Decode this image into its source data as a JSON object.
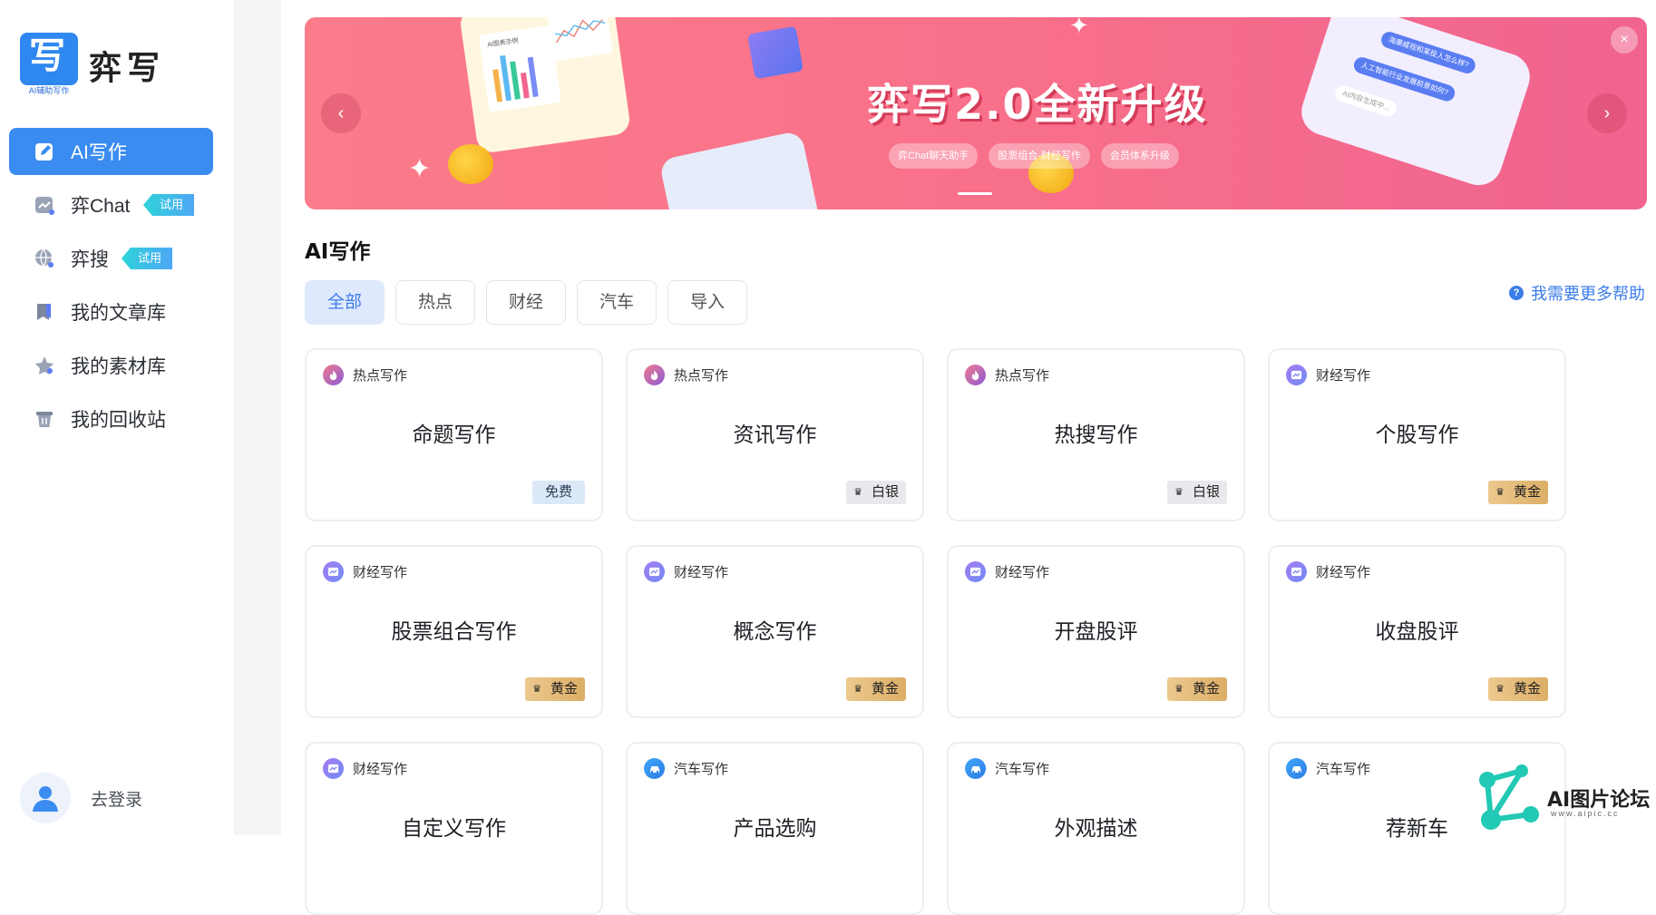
{
  "app": {
    "logo_text": "弈写",
    "logo_glyph": "写",
    "logo_sub": "AI辅助写作"
  },
  "sidebar": {
    "items": [
      {
        "label": "AI写作",
        "icon": "pen-icon",
        "active": true
      },
      {
        "label": "弈Chat",
        "icon": "chat-chart-icon",
        "badge": "试用"
      },
      {
        "label": "弈搜",
        "icon": "globe-search-icon",
        "badge": "试用"
      },
      {
        "label": "我的文章库",
        "icon": "bookmark-icon"
      },
      {
        "label": "我的素材库",
        "icon": "star-icon"
      },
      {
        "label": "我的回收站",
        "icon": "trash-icon"
      }
    ],
    "login_label": "去登录"
  },
  "banner": {
    "title": "弈写2.0全新升级",
    "chips": [
      "弈Chat聊天助手",
      "股票组合·财经写作",
      "会员体系升级"
    ],
    "chat_bubbles": [
      "海康威视和某投人怎么样?",
      "人工智能行业发展前景如何?",
      "AI内容生成中..."
    ],
    "chart_caption": "AI图表示例",
    "prev_arrow": "‹",
    "next_arrow": "›",
    "close": "×",
    "colors": {
      "start": "#fb7c8a",
      "end": "#f0648f"
    }
  },
  "section": {
    "title": "AI写作",
    "tabs": [
      {
        "label": "全部",
        "active": true
      },
      {
        "label": "热点"
      },
      {
        "label": "财经"
      },
      {
        "label": "汽车"
      },
      {
        "label": "导入"
      }
    ],
    "help_label": "我需要更多帮助"
  },
  "cards": [
    {
      "category": "热点写作",
      "cat_type": "hot",
      "title": "命题写作",
      "tier": "免费",
      "tier_type": "free"
    },
    {
      "category": "热点写作",
      "cat_type": "hot",
      "title": "资讯写作",
      "tier": "白银",
      "tier_type": "silver"
    },
    {
      "category": "热点写作",
      "cat_type": "hot",
      "title": "热搜写作",
      "tier": "白银",
      "tier_type": "silver"
    },
    {
      "category": "财经写作",
      "cat_type": "fin",
      "title": "个股写作",
      "tier": "黄金",
      "tier_type": "gold"
    },
    {
      "category": "财经写作",
      "cat_type": "fin",
      "title": "股票组合写作",
      "tier": "黄金",
      "tier_type": "gold"
    },
    {
      "category": "财经写作",
      "cat_type": "fin",
      "title": "概念写作",
      "tier": "黄金",
      "tier_type": "gold"
    },
    {
      "category": "财经写作",
      "cat_type": "fin",
      "title": "开盘股评",
      "tier": "黄金",
      "tier_type": "gold"
    },
    {
      "category": "财经写作",
      "cat_type": "fin",
      "title": "收盘股评",
      "tier": "黄金",
      "tier_type": "gold"
    },
    {
      "category": "财经写作",
      "cat_type": "fin",
      "title": "自定义写作",
      "tier": "",
      "tier_type": "none"
    },
    {
      "category": "汽车写作",
      "cat_type": "car",
      "title": "产品选购",
      "tier": "",
      "tier_type": "none"
    },
    {
      "category": "汽车写作",
      "cat_type": "car",
      "title": "外观描述",
      "tier": "",
      "tier_type": "none"
    },
    {
      "category": "汽车写作",
      "cat_type": "car",
      "title": "荐新车",
      "tier": "",
      "tier_type": "none"
    }
  ],
  "watermark": {
    "text": "AI图片论坛",
    "sub": "www.aipic.cc"
  },
  "colors": {
    "accent": "#3b8cf0",
    "badge": "#2ed3d8",
    "gold": "#dcae66",
    "silver": "#e7e9ec",
    "free": "#dbe8f8"
  }
}
